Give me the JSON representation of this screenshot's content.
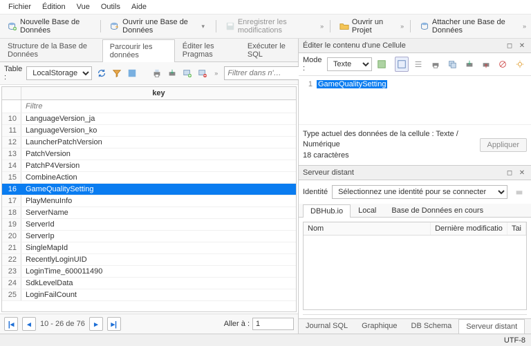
{
  "menu": [
    "Fichier",
    "Édition",
    "Vue",
    "Outils",
    "Aide"
  ],
  "toolbar": {
    "new_db": "Nouvelle Base de Données",
    "open_db": "Ouvrir une Base de Données",
    "save": "Enregistrer les modifications",
    "open_proj": "Ouvrir un Projet",
    "attach": "Attacher une Base de Données"
  },
  "left": {
    "tabs": [
      "Structure de la Base de Données",
      "Parcourir les données",
      "Éditer les Pragmas",
      "Exécuter le SQL"
    ],
    "active_tab": 1,
    "table_label": "Table :",
    "table_select": "LocalStorage",
    "filter_placeholder": "Filtrer dans n'…",
    "col_header": "key",
    "col_filter_placeholder": "Filtre",
    "rows": [
      {
        "n": 10,
        "v": "LanguageVersion_ja"
      },
      {
        "n": 11,
        "v": "LanguageVersion_ko"
      },
      {
        "n": 12,
        "v": "LauncherPatchVersion"
      },
      {
        "n": 13,
        "v": "PatchVersion"
      },
      {
        "n": 14,
        "v": "PatchP4Version"
      },
      {
        "n": 15,
        "v": "CombineAction"
      },
      {
        "n": 16,
        "v": "GameQualitySetting",
        "sel": true
      },
      {
        "n": 17,
        "v": "PlayMenuInfo"
      },
      {
        "n": 18,
        "v": "ServerName"
      },
      {
        "n": 19,
        "v": "ServerId"
      },
      {
        "n": 20,
        "v": "ServerIp"
      },
      {
        "n": 21,
        "v": "SingleMapId"
      },
      {
        "n": 22,
        "v": "RecentlyLoginUID"
      },
      {
        "n": 23,
        "v": "LoginTime_600011490"
      },
      {
        "n": 24,
        "v": "SdkLevelData"
      },
      {
        "n": 25,
        "v": "LoginFailCount"
      }
    ],
    "pager": {
      "range": "10 - 26 de 76",
      "goto_label": "Aller à :",
      "goto_value": "1"
    }
  },
  "cell_panel": {
    "title": "Éditer le contenu d'une Cellule",
    "mode_label": "Mode :",
    "mode_value": "Texte",
    "line": "1",
    "text": "GameQualitySetting",
    "type_line": "Type actuel des données de la cellule : Texte / Numérique",
    "chars_line": "18 caractères",
    "apply": "Appliquer"
  },
  "remote": {
    "title": "Serveur distant",
    "identity_label": "Identité",
    "identity_select": "Sélectionnez une identité pour se connecter",
    "tabs": [
      "DBHub.io",
      "Local",
      "Base de Données en cours"
    ],
    "cols": [
      "Nom",
      "Dernière modificatio",
      "Tai"
    ]
  },
  "bottom_tabs": [
    "Journal SQL",
    "Graphique",
    "DB Schema",
    "Serveur distant"
  ],
  "status": "UTF-8"
}
